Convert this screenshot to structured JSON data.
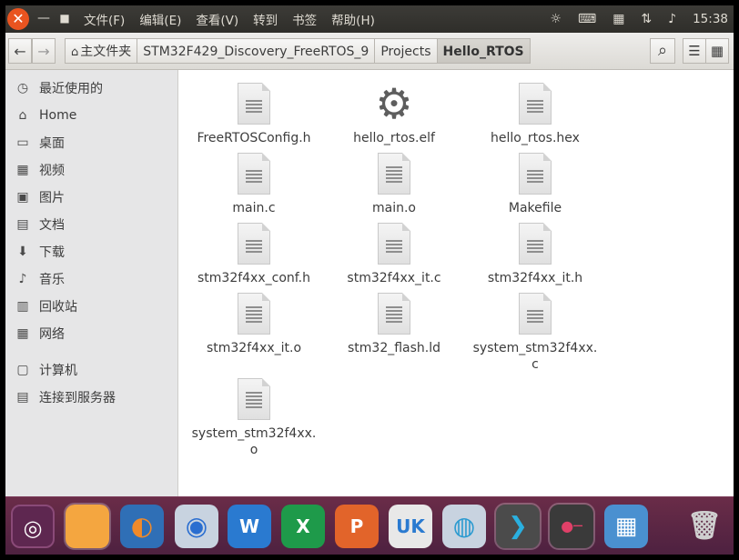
{
  "topbar": {
    "close_glyph": "✕",
    "minimize_glyph": "—",
    "maximize_glyph": "■",
    "menus": [
      "文件(F)",
      "编辑(E)",
      "查看(V)",
      "转到",
      "书签",
      "帮助(H)"
    ],
    "clock": "15:38",
    "tray_icons": [
      "weather-icon",
      "keyboard-icon",
      "calendar-icon",
      "network-icon",
      "volume-icon"
    ]
  },
  "toolbar": {
    "back_glyph": "←",
    "forward_glyph": "→",
    "breadcrumbs": [
      "主文件夹",
      "STM32F429_Discovery_FreeRTOS_9",
      "Projects",
      "Hello_RTOS"
    ],
    "search_glyph": "⌕",
    "list_glyph": "☰",
    "grid_glyph": "▦"
  },
  "sidebar": {
    "items": [
      {
        "label": "最近使用的",
        "icon": "recent-icon",
        "glyph": "◷"
      },
      {
        "label": "Home",
        "icon": "home-icon",
        "glyph": "⌂"
      },
      {
        "label": "桌面",
        "icon": "desktop-icon",
        "glyph": "▭"
      },
      {
        "label": "视频",
        "icon": "video-icon",
        "glyph": "▦"
      },
      {
        "label": "图片",
        "icon": "picture-icon",
        "glyph": "▣"
      },
      {
        "label": "文档",
        "icon": "document-icon",
        "glyph": "▤"
      },
      {
        "label": "下载",
        "icon": "download-icon",
        "glyph": "⬇"
      },
      {
        "label": "音乐",
        "icon": "music-icon",
        "glyph": "♪"
      },
      {
        "label": "回收站",
        "icon": "trash-icon",
        "glyph": "▥"
      },
      {
        "label": "网络",
        "icon": "network-places-icon",
        "glyph": "▦"
      },
      {
        "label": "计算机",
        "icon": "computer-icon",
        "glyph": "▢"
      },
      {
        "label": "连接到服务器",
        "icon": "server-icon",
        "glyph": "▤"
      }
    ]
  },
  "files": {
    "items": [
      {
        "name": "FreeRTOSConfig.h",
        "type": "text"
      },
      {
        "name": "hello_rtos.elf",
        "type": "exec"
      },
      {
        "name": "hello_rtos.hex",
        "type": "text"
      },
      {
        "name": "main.c",
        "type": "text"
      },
      {
        "name": "main.o",
        "type": "obj"
      },
      {
        "name": "Makefile",
        "type": "text"
      },
      {
        "name": "stm32f4xx_conf.h",
        "type": "text"
      },
      {
        "name": "stm32f4xx_it.c",
        "type": "text"
      },
      {
        "name": "stm32f4xx_it.h",
        "type": "text"
      },
      {
        "name": "stm32f4xx_it.o",
        "type": "obj"
      },
      {
        "name": "stm32_flash.ld",
        "type": "obj"
      },
      {
        "name": "system_stm32f4xx.c",
        "type": "text"
      },
      {
        "name": "system_stm32f4xx.o",
        "type": "obj"
      }
    ]
  },
  "dock": {
    "apps": [
      {
        "name": "ubuntu-icon",
        "color": "#5e2750",
        "glyph": "◎"
      },
      {
        "name": "files-icon",
        "color": "#f4a640",
        "glyph": ""
      },
      {
        "name": "firefox-icon",
        "color": "#2f6fb6",
        "glyph": "◐"
      },
      {
        "name": "chromium-icon",
        "color": "#c8d3e0",
        "glyph": "◉"
      },
      {
        "name": "writer-icon",
        "color": "#2a7ad0",
        "glyph": "W"
      },
      {
        "name": "calc-icon",
        "color": "#1e9a4a",
        "glyph": "X"
      },
      {
        "name": "impress-icon",
        "color": "#e2642a",
        "glyph": "P"
      },
      {
        "name": "software-center-icon",
        "color": "#e8e8e8",
        "glyph": "UK"
      },
      {
        "name": "system-tool-icon",
        "color": "#c8d3e0",
        "glyph": "◍"
      },
      {
        "name": "terminal-icon",
        "color": "#4b4b4b",
        "glyph": "❯"
      },
      {
        "name": "remote-desktop-icon",
        "color": "#3a3a3a",
        "glyph": "●─"
      },
      {
        "name": "workspace-icon",
        "color": "#4a90d0",
        "glyph": "▦"
      },
      {
        "name": "trash-dock-icon",
        "color": "#555555",
        "glyph": "🗑"
      }
    ]
  }
}
